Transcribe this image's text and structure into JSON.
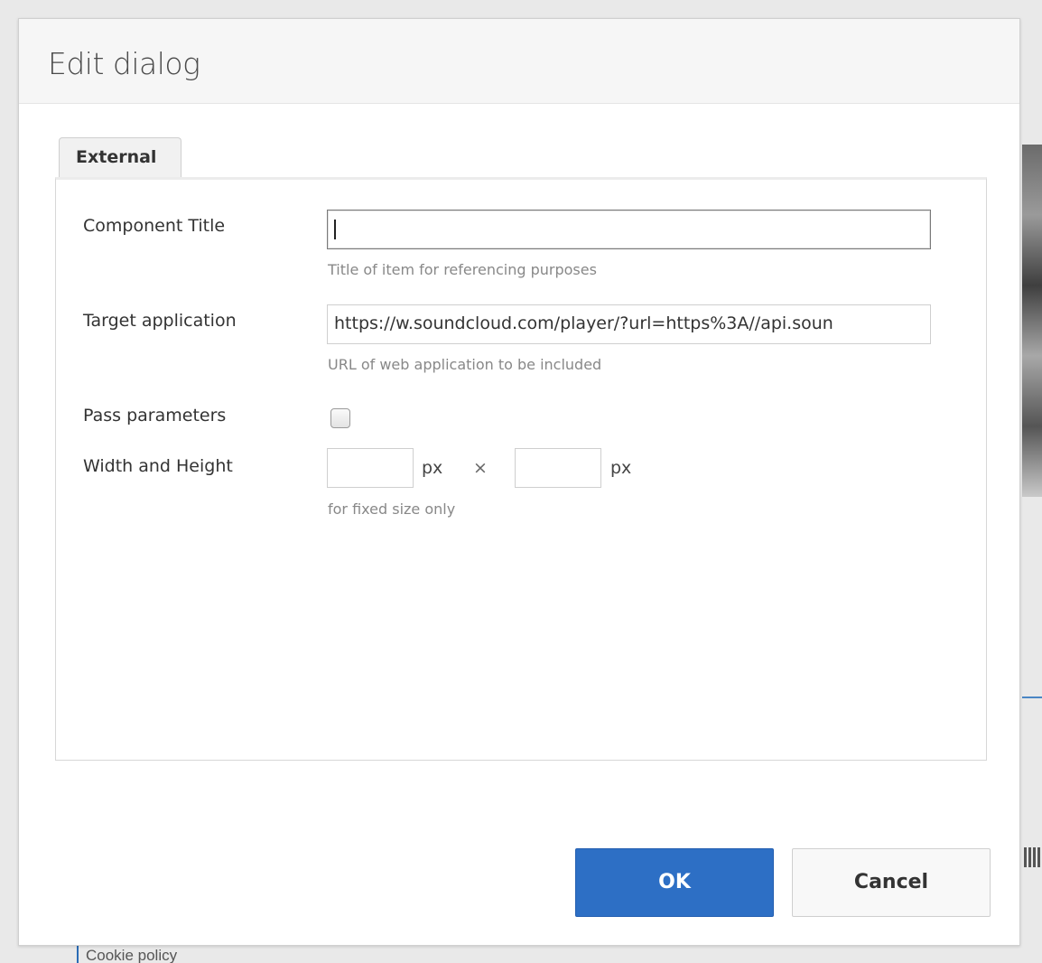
{
  "dialog": {
    "title": "Edit dialog",
    "tab_label": "External",
    "fields": {
      "component_title": {
        "label": "Component Title",
        "value": "",
        "hint": "Title of item for referencing purposes"
      },
      "target_application": {
        "label": "Target application",
        "value": "https://w.soundcloud.com/player/?url=https%3A//api.soun",
        "hint": "URL of web application to be included"
      },
      "pass_parameters": {
        "label": "Pass parameters",
        "checked": false
      },
      "width_height": {
        "label": "Width and Height",
        "width_value": "",
        "height_value": "",
        "unit": "px",
        "separator": "×",
        "hint": "for fixed size only"
      }
    },
    "ok_label": "OK",
    "cancel_label": "Cancel"
  },
  "background": {
    "footer_link": "Cookie policy"
  },
  "colors": {
    "primary": "#2d6fc5",
    "hint": "#888888"
  }
}
